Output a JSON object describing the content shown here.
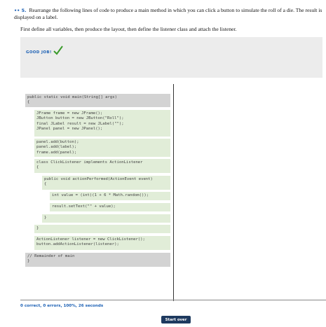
{
  "question": {
    "number": "•• 5.",
    "text": "Rearrange the following lines of code to produce a main method in which you can click a button to simulate the roll of a die. The result is displayed on a label.",
    "subtext": "First define all variables, then produce the layout, then define the listener class and attach the listener."
  },
  "feedback": {
    "label": "GOOD JOB!",
    "icon": "check-icon",
    "color": "#3a9a2a"
  },
  "code_blocks": [
    {
      "text": "public static void main(String[] args)\n{"
    },
    {
      "text": "JFrame frame = new JFrame();\nJButton button = new JButton(\"Roll\");\nfinal JLabel result = new JLabel(\"\");\nJPanel panel = new JPanel();"
    },
    {
      "text": "panel.add(button);\npanel.add(label);\nframe.add(panel);"
    },
    {
      "text": "class ClickListener implements ActionListener\n{"
    },
    {
      "text": "public void actionPerformed(ActionEvent event)\n{"
    },
    {
      "text": "int value = (int)(1 + 6 * Math.random());"
    },
    {
      "text": "result.setText(\"\" + value);"
    },
    {
      "text": "}"
    },
    {
      "text": "}"
    },
    {
      "text": "ActionListener listener = new ClickListener();\nbutton.addActionListener(listener);"
    },
    {
      "text": "// Remainder of main\n}"
    }
  ],
  "status": "0 correct, 0 errors, 100%, 26 seconds",
  "start_over": "Start over",
  "colors": {
    "accent": "#1a5fb4",
    "button": "#1e3a5f",
    "gray_block": "#d3d3d3",
    "green_block": "#e1edd8"
  }
}
